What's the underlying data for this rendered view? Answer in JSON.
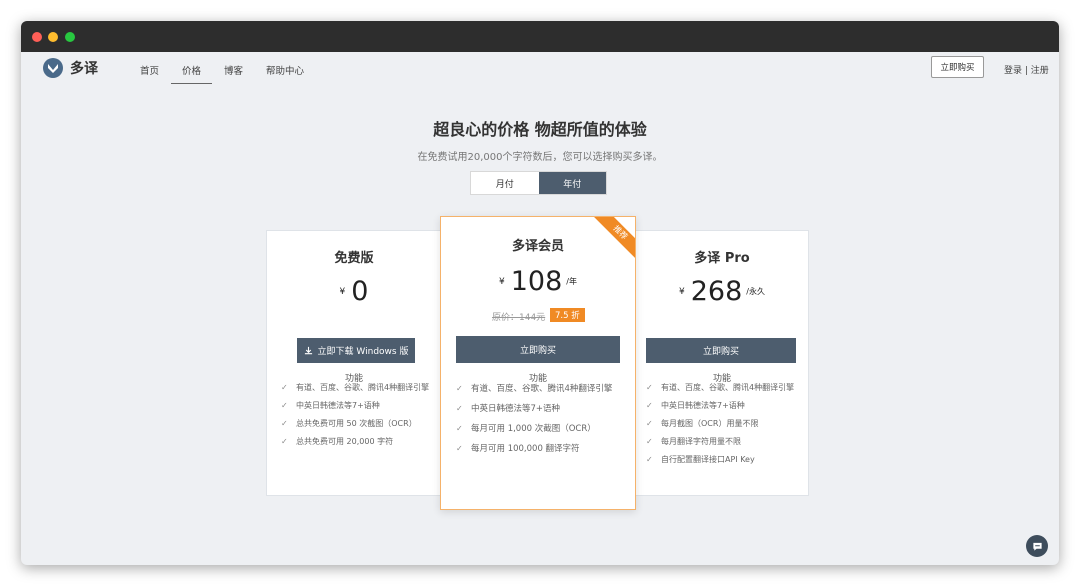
{
  "app": {
    "name": "多译"
  },
  "nav": {
    "items": [
      {
        "label": "首页"
      },
      {
        "label": "价格"
      },
      {
        "label": "博客"
      },
      {
        "label": "帮助中心"
      }
    ]
  },
  "header": {
    "buy_button": "立即购买",
    "login": "登录 | 注册"
  },
  "hero": {
    "title": "超良心的价格 物超所值的体验",
    "subtitle": "在免费试用20,000个字符数后，您可以选择购买多译。"
  },
  "billing_toggle": {
    "monthly": "月付",
    "yearly": "年付",
    "selected": "年付"
  },
  "plans": {
    "free": {
      "name": "免费版",
      "currency": "¥",
      "price": "0",
      "cta": "立即下载 Windows 版",
      "features_title": "功能",
      "features": [
        "有道、百度、谷歌、腾讯4种翻译引擎",
        "中英日韩德法等7+语种",
        "总共免费可用 50 次截图（OCR）",
        "总共免费可用 20,000 字符"
      ]
    },
    "member": {
      "name": "多译会员",
      "ribbon": "推荐",
      "currency": "¥",
      "price": "108",
      "period": "/年",
      "original_price": "原价：144元",
      "discount": "7.5 折",
      "cta": "立即购买",
      "features_title": "功能",
      "features": [
        "有道、百度、谷歌、腾讯4种翻译引擎",
        "中英日韩德法等7+语种",
        "每月可用 1,000 次截图（OCR）",
        "每月可用 100,000 翻译字符"
      ]
    },
    "pro": {
      "name": "多译 Pro",
      "currency": "¥",
      "price": "268",
      "period": "/永久",
      "cta": "立即购买",
      "features_title": "功能",
      "features": [
        "有道、百度、谷歌、腾讯4种翻译引擎",
        "中英日韩德法等7+语种",
        "每月截图（OCR）用量不限",
        "每月翻译字符用量不限",
        "自行配置翻译接口API Key"
      ]
    }
  },
  "colors": {
    "accent": "#f08a24",
    "primary_button": "#4d5d6e"
  }
}
